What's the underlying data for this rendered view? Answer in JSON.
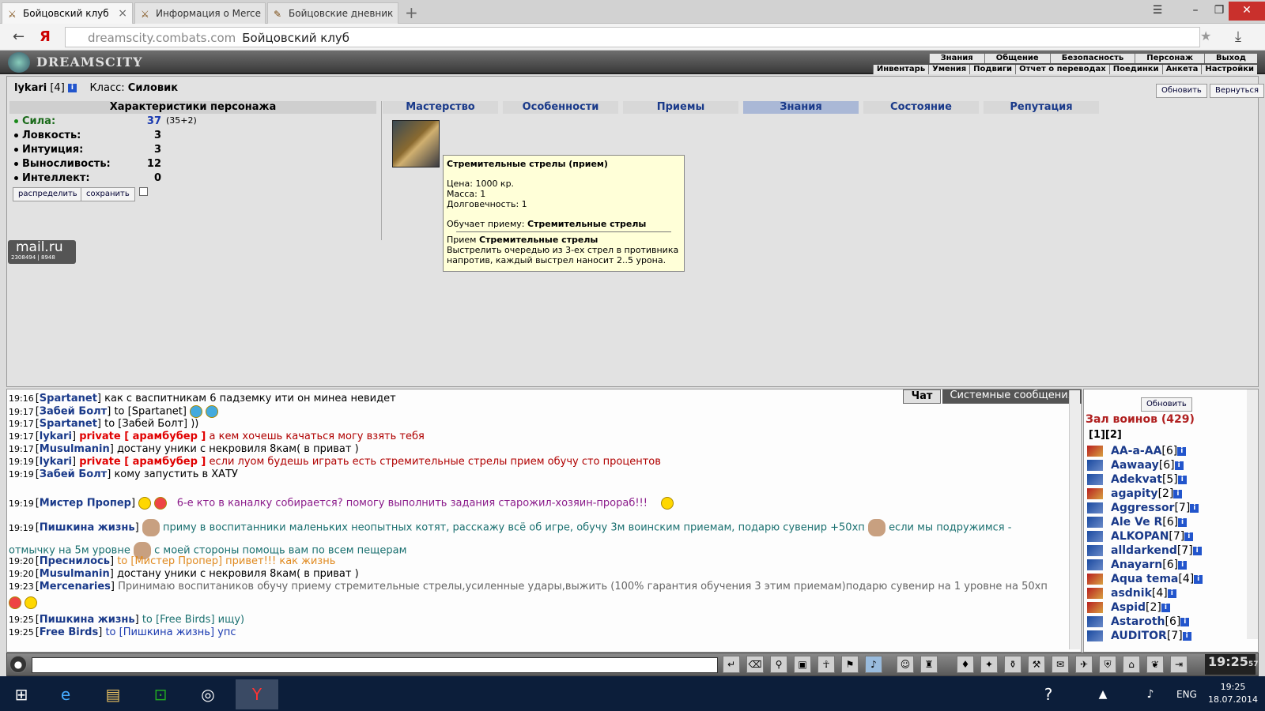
{
  "browser": {
    "tabs": [
      {
        "title": "Бойцовский клуб",
        "active": true
      },
      {
        "title": "Информация о Merce",
        "active": false
      },
      {
        "title": "Бойцовские дневник",
        "active": false
      }
    ],
    "url_domain": "dreamscity.combats.com",
    "url_title": "Бойцовский клуб",
    "back_glyph": "←",
    "yandex_glyph": "Я"
  },
  "game": {
    "logo": "DREAMSCITY",
    "topmenu": [
      "Знания",
      "Общение",
      "Безопасность",
      "Персонаж",
      "Выход"
    ],
    "submenu": [
      "Инвентарь",
      "Умения",
      "Подвиги",
      "Отчет о переводах",
      "Поединки",
      "Анкета",
      "Настройки"
    ],
    "refresh_btn": "Обновить",
    "back_btn": "Вернуться"
  },
  "character": {
    "nick": "lykari",
    "level": "[4]",
    "class_label": "Класс:",
    "class_value": "Силовик",
    "stats_title": "Характеристики персонажа",
    "stats": [
      {
        "label": "Сила:",
        "value": "37",
        "bonus": "(35+2)"
      },
      {
        "label": "Ловкость:",
        "value": "3"
      },
      {
        "label": "Интуиция:",
        "value": "3"
      },
      {
        "label": "Выносливость:",
        "value": "12"
      },
      {
        "label": "Интеллект:",
        "value": "0"
      }
    ],
    "distribute_btn": "распределить",
    "save_btn": "сохранить"
  },
  "nav_tabs": [
    "Мастерство",
    "Особенности",
    "Приемы",
    "Знания",
    "Состояние",
    "Репутация"
  ],
  "tooltip": {
    "title": "Стремительные стрелы (прием)",
    "price": "Цена: 1000 кр.",
    "mass": "Масса: 1",
    "durability": "Долговечность: 1",
    "teaches_label": "Обучает приему:",
    "teaches_value": "Стремительные стрелы",
    "skill_label": "Прием",
    "skill_value": "Стремительные стрелы",
    "desc": "Выстрелить очередью из 3-ех стрел в противника напротив, каждый выстрел наносит 2..5 урона."
  },
  "mailru": {
    "brand": "mail.ru",
    "counter": "2308494 | 8948"
  },
  "chat": {
    "tab_chat": "Чат",
    "tab_system": "Системные сообщения",
    "lines": [
      {
        "time": "19:16",
        "nick": "Spartanet",
        "text": "как с васпитникам 6 падземку ити он минеа невидет"
      },
      {
        "time": "19:17",
        "nick": "Забей Болт",
        "to": "to [Spartanet]"
      },
      {
        "time": "19:17",
        "nick": "Spartanet",
        "text": "to [Забей Болт] ))"
      },
      {
        "time": "19:17",
        "nick": "lykari",
        "private": "private [ арамбубер ]",
        "text": "а кем хочешь качаться могу взять тебя"
      },
      {
        "time": "19:17",
        "nick": "Musulmanin",
        "text": "достану уники с некровиля 8кам( в приват )"
      },
      {
        "time": "19:19",
        "nick": "lykari",
        "private": "private [ арамбубер ]",
        "text": "если луом будешь играть есть стремительные стрелы прием обучу сто процентов"
      },
      {
        "time": "19:19",
        "nick": "Забей Болт",
        "text": "кому запустить в ХАТУ"
      },
      {
        "time": "19:19",
        "nick": "Мистер Пропер",
        "text": "6-е кто в каналку собирается? помогу выполнить задания старожил-хозяин-прораб!!!"
      },
      {
        "time": "19:19",
        "nick": "Пишкина жизнь",
        "text": "приму в воспитанники маленьких неопытных котят, расскажу всё об игре, обучу 3м воинским приемам, подарю сувенир +50хп",
        "text2": "если мы подружимся -",
        "text3": "отмычку на 5м уровне",
        "text4": "с моей стороны помощь вам по всем пещерам"
      },
      {
        "time": "19:20",
        "nick": "Преснилось",
        "text": "to [Мистер Пропер] привет!!! как жизнь"
      },
      {
        "time": "19:20",
        "nick": "Musulmanin",
        "text": "достану уники с некровиля 8кам( в приват )"
      },
      {
        "time": "19:23",
        "nick": "Mercenaries",
        "text": "Принимаю воспитаников обучу приему стремительные стрелы,усиленные удары,выжить (100% гарантия обучения 3 этим приемам)подарю сувенир на 1 уровне на 50хп"
      },
      {
        "time": "19:25",
        "nick": "Пишкина жизнь",
        "text": "to [Free Birds] ищу)"
      },
      {
        "time": "19:25",
        "nick": "Free Birds",
        "text": "to [Пишкина жизнь] упс"
      }
    ]
  },
  "users": {
    "refresh_btn": "Обновить",
    "header": "Зал воинов (429)",
    "pages": "[1][2]",
    "list": [
      {
        "name": "AA-a-AA",
        "level": "[6]"
      },
      {
        "name": "Aawaay",
        "level": "[6]"
      },
      {
        "name": "Adekvat",
        "level": "[5]"
      },
      {
        "name": "agapity",
        "level": "[2]"
      },
      {
        "name": "Aggressor",
        "level": "[7]"
      },
      {
        "name": "Ale Ve R",
        "level": "[6]"
      },
      {
        "name": "ALKOPAN",
        "level": "[7]"
      },
      {
        "name": "alldarkend",
        "level": "[7]"
      },
      {
        "name": "Anayarn",
        "level": "[6]"
      },
      {
        "name": "Aqua tema",
        "level": "[4]"
      },
      {
        "name": "asdnik",
        "level": "[4]"
      },
      {
        "name": "Aspid",
        "level": "[2]"
      },
      {
        "name": "Astaroth",
        "level": "[6]"
      },
      {
        "name": "AUDITOR",
        "level": "[7]"
      }
    ]
  },
  "clock": {
    "time": "19:25",
    "sec": "57"
  },
  "taskbar": {
    "lang": "ENG",
    "time": "19:25",
    "date": "18.07.2014"
  },
  "colors": {
    "accent": "#1a3a8a",
    "private": "#e00000",
    "header_bg": "#4a4a4a"
  }
}
